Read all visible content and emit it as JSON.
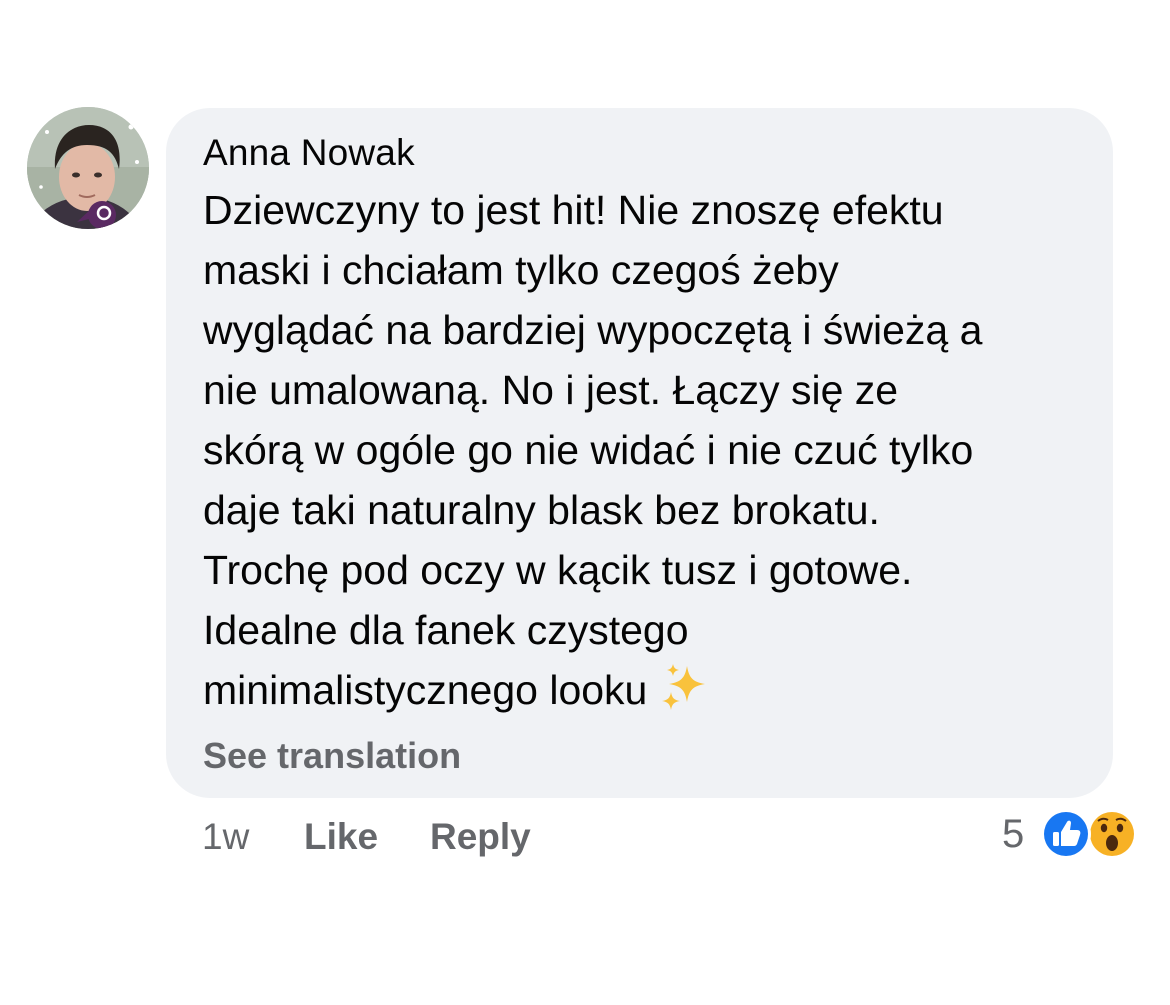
{
  "comment": {
    "author": "Anna Nowak",
    "lines": [
      "Dziewczyny to jest hit! Nie znoszę efektu",
      "maski i chciałam tylko czegoś żeby",
      "wyglądać na bardziej wypoczętą i świeżą a",
      "nie umalowaną. No i jest. Łączy się ze",
      "skórą w ogóle go nie widać i nie czuć tylko",
      "daje taki naturalny blask bez brokatu.",
      "Trochę pod oczy w kącik tusz i gotowe.",
      "Idealne dla fanek czystego",
      "minimalistycznego looku"
    ],
    "emoji": "sparkles-icon",
    "see_translation": "See translation"
  },
  "actions": {
    "time": "1w",
    "like": "Like",
    "reply": "Reply"
  },
  "reactions": {
    "count": "5",
    "types": [
      "like-icon",
      "wow-icon"
    ]
  },
  "colors": {
    "bubble": "#f0f2f5",
    "text": "#050505",
    "secondary_text": "#65676b",
    "like_blue": "#1877f2",
    "wow_yellow": "#f7b125"
  }
}
